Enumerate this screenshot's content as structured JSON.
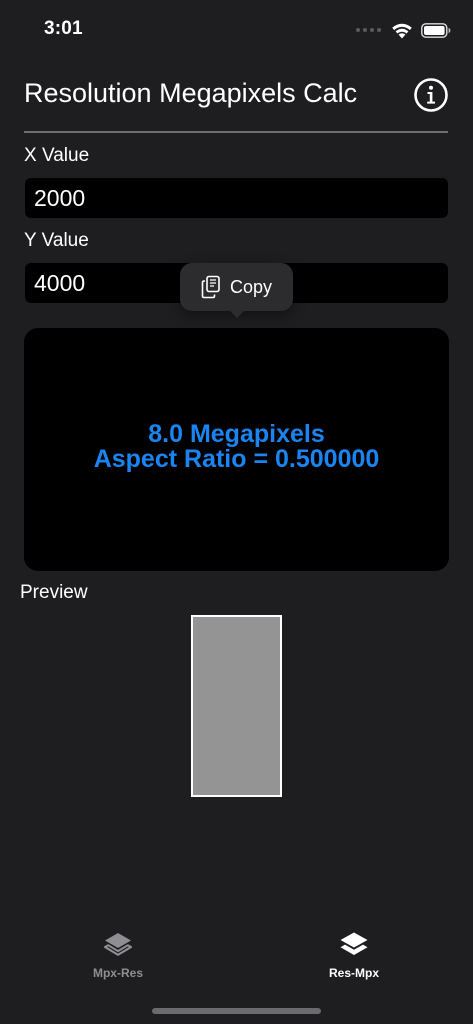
{
  "status_bar": {
    "time": "3:01"
  },
  "header": {
    "title": "Resolution Megapixels Calc",
    "info_icon": "info-circle-icon"
  },
  "fields": {
    "x": {
      "label": "X Value",
      "value": "2000"
    },
    "y": {
      "label": "Y Value",
      "value": "4000"
    }
  },
  "copy_menu": {
    "label": "Copy",
    "icon": "copy-icon"
  },
  "result": {
    "megapixels_text": "8.0 Megapixels",
    "aspect_ratio_text": "Aspect Ratio = 0.500000",
    "color": "#1a84f2"
  },
  "preview": {
    "label": "Preview",
    "aspect_ratio": 0.5,
    "fill_color": "#949494"
  },
  "tab_bar": {
    "tabs": [
      {
        "label": "Mpx-Res",
        "icon": "layers-icon",
        "selected": false
      },
      {
        "label": "Res-Mpx",
        "icon": "layers-filled-icon",
        "selected": true
      }
    ]
  }
}
